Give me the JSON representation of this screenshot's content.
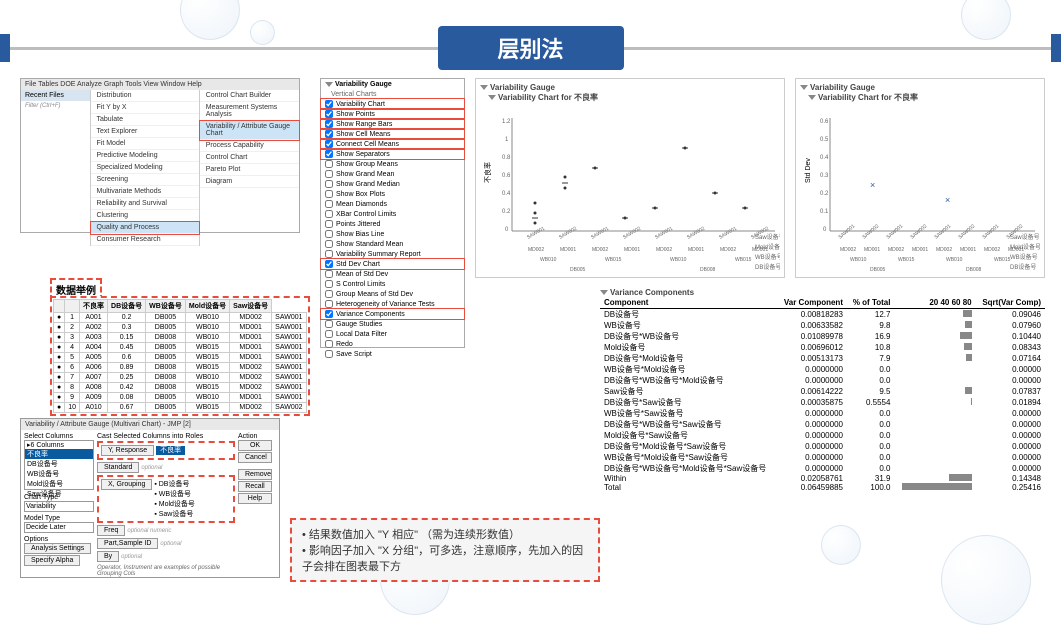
{
  "title": "层别法",
  "menubar": "File  Tables  DOE  Analyze  Graph  Tools  View  Window  Help",
  "recent": "Recent Files",
  "filter": "Filter (Ctrl+F)",
  "analyze_menu": [
    "Distribution",
    "Fit Y by X",
    "Tabulate",
    "Text Explorer",
    "Fit Model",
    "Predictive Modeling",
    "Specialized Modeling",
    "Screening",
    "Multivariate Methods",
    "Reliability and Survival",
    "Clustering",
    "Quality and Process",
    "Consumer Research"
  ],
  "submenu": [
    "Control Chart Builder",
    "Measurement Systems Analysis",
    "Variability / Attribute Gauge Chart",
    "Process Capability",
    "Control Chart",
    "Pareto Plot",
    "Diagram"
  ],
  "vg_title": "Variability Gauge",
  "vg_sub": "Vertical Charts",
  "vg_opts": [
    "Variability Chart",
    "Show Points",
    "Show Range Bars",
    "Show Cell Means",
    "Connect Cell Means",
    "Show Separators",
    "Show Group Means",
    "Show Grand Mean",
    "Show Grand Median",
    "Show Box Plots",
    "Mean Diamonds",
    "XBar Control Limits",
    "Points Jittered",
    "Show Bias Line",
    "Show Standard Mean",
    "Variability Summary Report",
    "Std Dev Chart",
    "Mean of Std Dev",
    "S Control Limits",
    "Group Means of Std Dev",
    "Heterogeneity of Variance Tests",
    "Variance Components",
    "Gauge Studies",
    "Local Data Filter",
    "Redo",
    "Save Script"
  ],
  "datalabel": "数据举例",
  "cols": [
    "",
    "不良率",
    "DB设备号",
    "WB设备号",
    "Mold设备号",
    "Saw设备号"
  ],
  "rows": [
    [
      "1",
      "A001",
      "0.2",
      "DB005",
      "WB010",
      "MD002",
      "SAW001"
    ],
    [
      "2",
      "A002",
      "0.3",
      "DB005",
      "WB010",
      "MD001",
      "SAW001"
    ],
    [
      "3",
      "A003",
      "0.15",
      "DB008",
      "WB010",
      "MD001",
      "SAW001"
    ],
    [
      "4",
      "A004",
      "0.45",
      "DB005",
      "WB015",
      "MD001",
      "SAW001"
    ],
    [
      "5",
      "A005",
      "0.6",
      "DB005",
      "WB015",
      "MD001",
      "SAW001"
    ],
    [
      "6",
      "A006",
      "0.89",
      "DB008",
      "WB015",
      "MD002",
      "SAW001"
    ],
    [
      "7",
      "A007",
      "0.25",
      "DB008",
      "WB010",
      "MD002",
      "SAW001"
    ],
    [
      "8",
      "A008",
      "0.42",
      "DB008",
      "WB015",
      "MD002",
      "SAW001"
    ],
    [
      "9",
      "A009",
      "0.08",
      "DB005",
      "WB010",
      "MD001",
      "SAW001"
    ],
    [
      "10",
      "A010",
      "0.67",
      "DB005",
      "WB015",
      "MD002",
      "SAW002"
    ]
  ],
  "dlg": {
    "selcols": "Select Columns",
    "castcols": "Cast Selected Columns into Roles",
    "cols": [
      "▸6 Columns",
      "不良率",
      "DB设备号",
      "WB设备号",
      "Mold设备号",
      "Saw设备号"
    ],
    "yresp": "Y, Response",
    "ycol": "不良率",
    "std": "Standard",
    "xgrp": "X, Grouping",
    "xcols": [
      "DB设备号",
      "WB设备号",
      "Mold设备号",
      "Saw设备号"
    ],
    "freq": "Freq",
    "partid": "Part,Sample ID",
    "by": "By",
    "charttype": "Chart Type",
    "variability": "Variability",
    "modeltype": "Model Type",
    "decide": "Decide Later",
    "opts": "Options",
    "anaset": "Analysis Settings",
    "specalpha": "Specify Alpha",
    "action": "Action",
    "ok": "OK",
    "cancel": "Cancel",
    "remove": "Remove",
    "recall": "Recall",
    "help": "Help",
    "opnote": "Operator, Instrument are examples of possible Grouping Cols"
  },
  "chart1": {
    "title": "Variability Gauge",
    "sub": "Variability Chart for 不良率",
    "ylabel": "不良率",
    "xlabels": [
      "SAW001",
      "SAW002",
      "SAW001",
      "SAW002",
      "SAW001",
      "SAW002",
      "SAW001",
      "SAW002"
    ],
    "mold": [
      "MD002",
      "MD001",
      "MD002",
      "MD001",
      "MD002",
      "MD001",
      "MD002",
      "MD001"
    ],
    "wb": [
      "WB010",
      "WB015",
      "WB010",
      "WB015"
    ],
    "db": [
      "DB005",
      "DB008"
    ],
    "axis": [
      "Saw设备号",
      "Mold设备号",
      "WB设备号",
      "DB设备号"
    ]
  },
  "chart2": {
    "title": "Variability Gauge",
    "sub": "Variability Chart for 不良率",
    "ylabel": "Std Dev"
  },
  "vartitle": "Variance Components",
  "varhdr": [
    "Component",
    "Var Component",
    "% of Total",
    "20 40 60 80",
    "Sqrt(Var Comp)"
  ],
  "varrows": [
    [
      "DB设备号",
      "0.00818283",
      "12.7",
      "",
      "0.09046"
    ],
    [
      "WB设备号",
      "0.00633582",
      "9.8",
      "",
      "0.07960"
    ],
    [
      "DB设备号*WB设备号",
      "0.01089978",
      "16.9",
      "",
      "0.10440"
    ],
    [
      "Mold设备号",
      "0.00696012",
      "10.8",
      "",
      "0.08343"
    ],
    [
      "DB设备号*Mold设备号",
      "0.00513173",
      "7.9",
      "",
      "0.07164"
    ],
    [
      "WB设备号*Mold设备号",
      "0.0000000",
      "0.0",
      "",
      "0.00000"
    ],
    [
      "DB设备号*WB设备号*Mold设备号",
      "0.0000000",
      "0.0",
      "",
      "0.00000"
    ],
    [
      "Saw设备号",
      "0.00614222",
      "9.5",
      "",
      "0.07837"
    ],
    [
      "DB设备号*Saw设备号",
      "0.00035875",
      "0.5554",
      "",
      "0.01894"
    ],
    [
      "WB设备号*Saw设备号",
      "0.0000000",
      "0.0",
      "",
      "0.00000"
    ],
    [
      "DB设备号*WB设备号*Saw设备号",
      "0.0000000",
      "0.0",
      "",
      "0.00000"
    ],
    [
      "Mold设备号*Saw设备号",
      "0.0000000",
      "0.0",
      "",
      "0.00000"
    ],
    [
      "DB设备号*Mold设备号*Saw设备号",
      "0.0000000",
      "0.0",
      "",
      "0.00000"
    ],
    [
      "WB设备号*Mold设备号*Saw设备号",
      "0.0000000",
      "0.0",
      "",
      "0.00000"
    ],
    [
      "DB设备号*WB设备号*Mold设备号*Saw设备号",
      "0.0000000",
      "0.0",
      "",
      "0.00000"
    ],
    [
      "Within",
      "0.02058761",
      "31.9",
      "",
      "0.14348"
    ],
    [
      "Total",
      "0.06459885",
      "100.0",
      "",
      "0.25416"
    ]
  ],
  "note1": "结果数值加入 \"Y 相应\" （需为连续形数值）",
  "note2": "影响因子加入 \"X 分组\"，可多选，注意顺序，先加入的因子会排在图表最下方",
  "chart_data": {
    "type": "scatter",
    "title": "Variability Chart for 不良率",
    "ylabel": "不良率",
    "ylim": [
      0,
      1.2
    ],
    "yticks": [
      0,
      0.2,
      0.4,
      0.6,
      0.8,
      1,
      1.2
    ],
    "series": [
      {
        "name": "不良率",
        "values": [
          0.2,
          0.3,
          0.15,
          0.45,
          0.6,
          0.89,
          0.25,
          0.42,
          0.08,
          0.67
        ]
      }
    ],
    "std_chart": {
      "ylabel": "Std Dev",
      "ylim": [
        0,
        0.6
      ],
      "yticks": [
        0,
        0.1,
        0.2,
        0.3,
        0.4,
        0.5,
        0.6
      ]
    }
  }
}
